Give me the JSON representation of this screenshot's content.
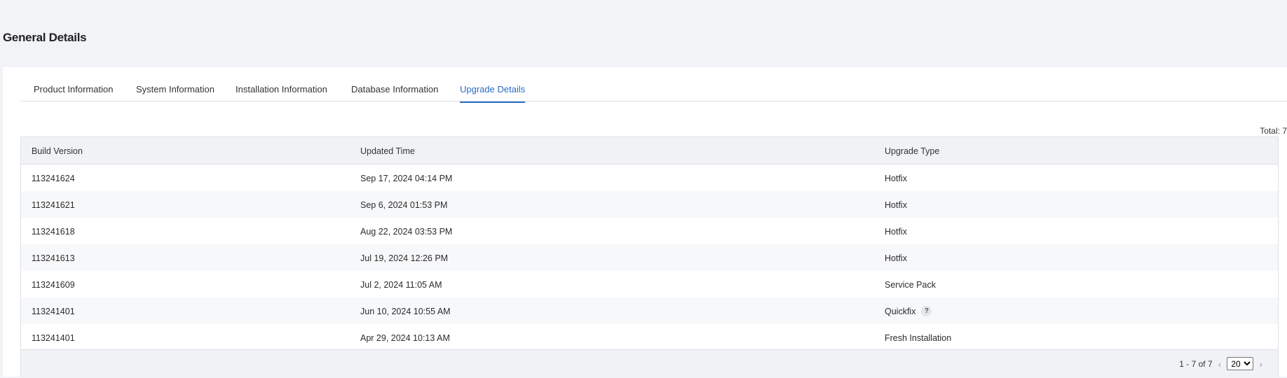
{
  "page": {
    "title": "General Details"
  },
  "tabs": [
    {
      "label": "Product Information",
      "active": false
    },
    {
      "label": "System Information",
      "active": false
    },
    {
      "label": "Installation Information",
      "active": false
    },
    {
      "label": "Database Information",
      "active": false
    },
    {
      "label": "Upgrade Details",
      "active": true
    }
  ],
  "table": {
    "total_label": "Total: 7",
    "columns": [
      "Build Version",
      "Updated Time",
      "Upgrade Type"
    ],
    "rows": [
      {
        "build": "113241624",
        "time": "Sep 17, 2024 04:14 PM",
        "type": "Hotfix"
      },
      {
        "build": "113241621",
        "time": "Sep 6, 2024 01:53 PM",
        "type": "Hotfix"
      },
      {
        "build": "113241618",
        "time": "Aug 22, 2024 03:53 PM",
        "type": "Hotfix"
      },
      {
        "build": "113241613",
        "time": "Jul 19, 2024 12:26 PM",
        "type": "Hotfix"
      },
      {
        "build": "113241609",
        "time": "Jul 2, 2024 11:05 AM",
        "type": "Service Pack"
      },
      {
        "build": "113241401",
        "time": "Jun 10, 2024 10:55 AM",
        "type": "Quickfix",
        "help_icon": "?"
      },
      {
        "build": "113241401",
        "time": "Apr 29, 2024 10:13 AM",
        "type": "Fresh Installation"
      }
    ]
  },
  "pagination": {
    "range": "1 - 7 of 7",
    "prev_icon": "‹",
    "next_icon": "›",
    "page_size": "20",
    "page_size_options": [
      "20"
    ]
  },
  "colors": {
    "accent": "#2a6cc4",
    "header_bg": "#f1f2f5",
    "page_bg": "#f2f3f6"
  }
}
